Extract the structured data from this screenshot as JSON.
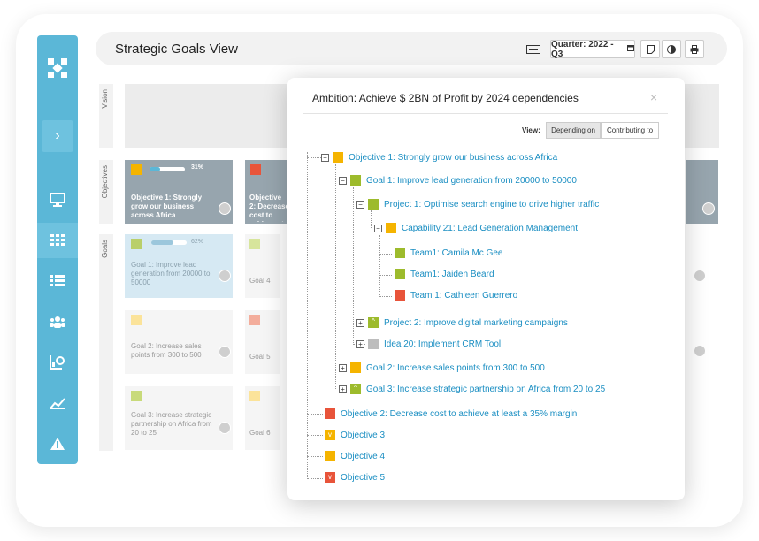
{
  "header": {
    "title": "Strategic Goals View",
    "quarter_label": "Quarter: 2022 - Q3"
  },
  "lanes": {
    "vision": "Vision",
    "objectives": "Objectives",
    "goals": "Goals"
  },
  "objective_cards": [
    {
      "title": "Objective 1: Strongly grow our business across Africa",
      "progress": "31%"
    },
    {
      "title": "Objective 2: Decrease cost to achieve at least a 35% margin"
    }
  ],
  "goal_cards": [
    {
      "title": "Goal 1: Improve lead generation from 20000 to 50000",
      "progress": "62%"
    },
    {
      "title": "Goal 4"
    },
    {
      "title": "Goal 2: Increase sales points from 300 to 500"
    },
    {
      "title": "Goal 5"
    },
    {
      "title": "Goal 3: Increase strategic partnership on Africa from 20 to 25"
    },
    {
      "title": "Goal 6"
    }
  ],
  "modal": {
    "title": "Ambition: Achieve $ 2BN of Profit by 2024 dependencies",
    "close": "×",
    "view_label": "View:",
    "view_options": [
      "Depending on",
      "Contributing to"
    ],
    "tree": [
      {
        "label": "Objective 1: Strongly grow our business across Africa",
        "bold": false
      },
      {
        "label": "Goal 1: Improve lead generation from 20000 to 50000"
      },
      {
        "label": "Project 1: Optimise search engine to drive higher traffic"
      },
      {
        "label": "Capability 21: Lead Generation Management"
      },
      {
        "label": "Team1: Camila Mc Gee"
      },
      {
        "label": "Team1: Jaiden Beard"
      },
      {
        "label": "Team 1: Cathleen Guerrero"
      },
      {
        "label": "Project 2: Improve digital marketing campaigns"
      },
      {
        "label": "Idea 20: Implement CRM Tool"
      },
      {
        "label": "Goal 2: Increase sales points from 300 to 500"
      },
      {
        "label": "Goal 3: Increase strategic partnership on Africa from 20 to 25"
      },
      {
        "label": "Objective 2: Decrease cost to achieve at least a 35% margin"
      },
      {
        "label": "Objective 3"
      },
      {
        "label": "Objective 4"
      },
      {
        "label": "Objective 5"
      }
    ]
  },
  "colors": {
    "sidebar": "#5bb7d7",
    "link": "#1a8ec2",
    "green": "#9dbb2c",
    "yellow": "#f5b400",
    "red": "#e8543a",
    "gray": "#bdbdbd"
  },
  "icons": [
    "logo-icon",
    "chevron-right-icon",
    "monitor-icon",
    "grid-icon",
    "list-icon",
    "team-icon",
    "chart-settings-icon",
    "trend-icon",
    "warning-icon",
    "keyboard-icon",
    "calendar-icon",
    "note-icon",
    "contrast-icon",
    "print-icon"
  ]
}
